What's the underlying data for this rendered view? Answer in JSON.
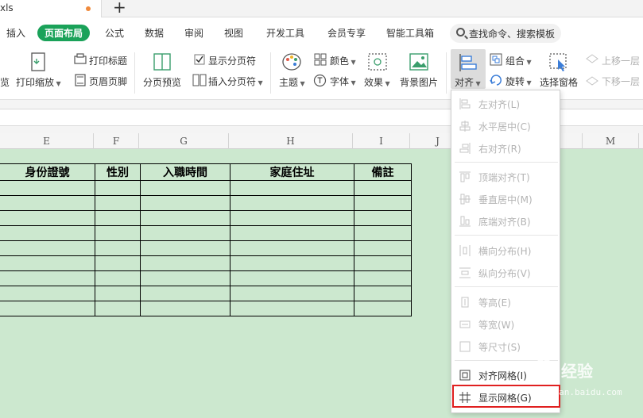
{
  "titlebar": {
    "file_tab": "xls",
    "new_tab": "+"
  },
  "menubar": {
    "items": [
      "插入",
      "页面布局",
      "公式",
      "数据",
      "审阅",
      "视图",
      "开发工具",
      "会员专享",
      "智能工具箱"
    ],
    "active": "页面布局",
    "search_placeholder": "查找命令、搜索模板"
  },
  "ribbon": {
    "partial_label": "览",
    "print_scale": "打印缩放",
    "print_title": "打印标题",
    "header_footer": "页眉页脚",
    "page_break_preview": "分页预览",
    "show_page_break": "显示分页符",
    "insert_page_break": "插入分页符",
    "theme": "主题",
    "color": "颜色",
    "font": "字体",
    "effect": "效果",
    "background": "背景图片",
    "align": "对齐",
    "group": "组合",
    "rotate": "旋转",
    "selection_pane": "选择窗格",
    "bring_forward": "上移一层",
    "send_backward": "下移一层"
  },
  "columns": [
    "E",
    "F",
    "G",
    "H",
    "I",
    "J",
    "M"
  ],
  "table": {
    "headers": [
      "身份證號",
      "性別",
      "入職時間",
      "家庭住址",
      "備註"
    ],
    "empty_rows": 9
  },
  "align_menu": {
    "items": [
      {
        "label": "左对齐(L)",
        "enabled": false,
        "icon": "align-left-icon"
      },
      {
        "label": "水平居中(C)",
        "enabled": false,
        "icon": "align-center-icon"
      },
      {
        "label": "右对齐(R)",
        "enabled": false,
        "icon": "align-right-icon"
      },
      {
        "label": "顶端对齐(T)",
        "enabled": false,
        "icon": "align-top-icon"
      },
      {
        "label": "垂直居中(M)",
        "enabled": false,
        "icon": "align-middle-icon"
      },
      {
        "label": "底端对齐(B)",
        "enabled": false,
        "icon": "align-bottom-icon"
      },
      {
        "label": "横向分布(H)",
        "enabled": false,
        "icon": "distribute-horizontal-icon"
      },
      {
        "label": "纵向分布(V)",
        "enabled": false,
        "icon": "distribute-vertical-icon"
      },
      {
        "label": "等高(E)",
        "enabled": false,
        "icon": "same-height-icon"
      },
      {
        "label": "等宽(W)",
        "enabled": false,
        "icon": "same-width-icon"
      },
      {
        "label": "等尺寸(S)",
        "enabled": false,
        "icon": "same-size-icon"
      },
      {
        "label": "对齐网格(I)",
        "enabled": true,
        "icon": "snap-to-grid-icon"
      },
      {
        "label": "显示网格(G)",
        "enabled": true,
        "icon": "show-grid-icon",
        "highlighted": true
      }
    ]
  },
  "watermark": {
    "brand": "经验",
    "url": "jingyan.baidu.com"
  },
  "colors": {
    "accent": "#1aa259",
    "sheet_bg": "#cce8cf",
    "highlight": "#e02020"
  }
}
